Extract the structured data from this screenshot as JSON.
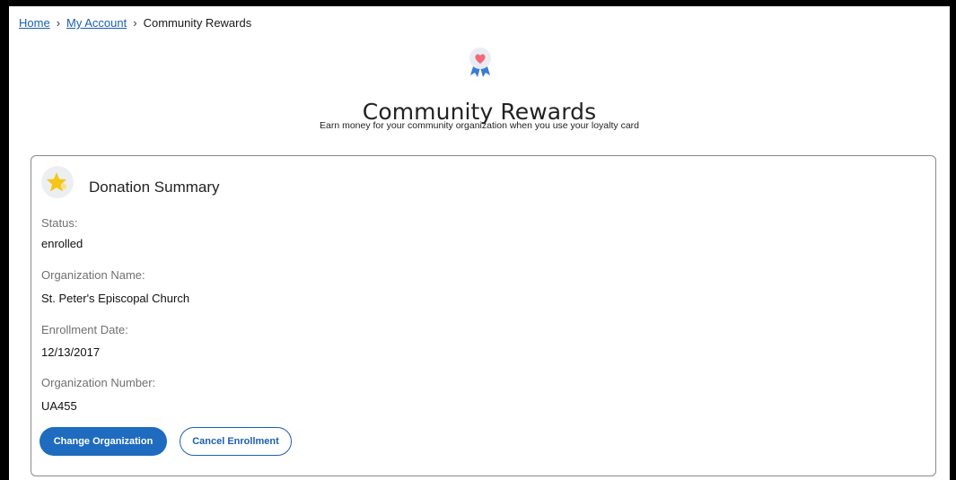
{
  "breadcrumb": {
    "home": "Home",
    "separator": "›",
    "my_account": "My Account",
    "current": "Community Rewards"
  },
  "header": {
    "icon": "ribbon-badge-heart-icon",
    "title": "Community Rewards",
    "subtitle": "Earn money for your community organization when you use your loyalty card"
  },
  "card": {
    "icon": "star-icon",
    "title": "Donation Summary",
    "fields": [
      {
        "label": "Status:",
        "value": "enrolled"
      },
      {
        "label": "Organization Name:",
        "value": "St. Peter's Episcopal Church"
      },
      {
        "label": "Enrollment Date:",
        "value": "12/13/2017"
      },
      {
        "label": "Organization Number:",
        "value": "UA455"
      }
    ],
    "buttons": {
      "change": "Change Organization",
      "cancel": "Cancel Enrollment"
    }
  },
  "colors": {
    "primary": "#1f6bbf",
    "link": "#1a5fb4",
    "star": "#f5c518",
    "heart": "#f26b7a",
    "ribbon": "#3a7bd5"
  }
}
